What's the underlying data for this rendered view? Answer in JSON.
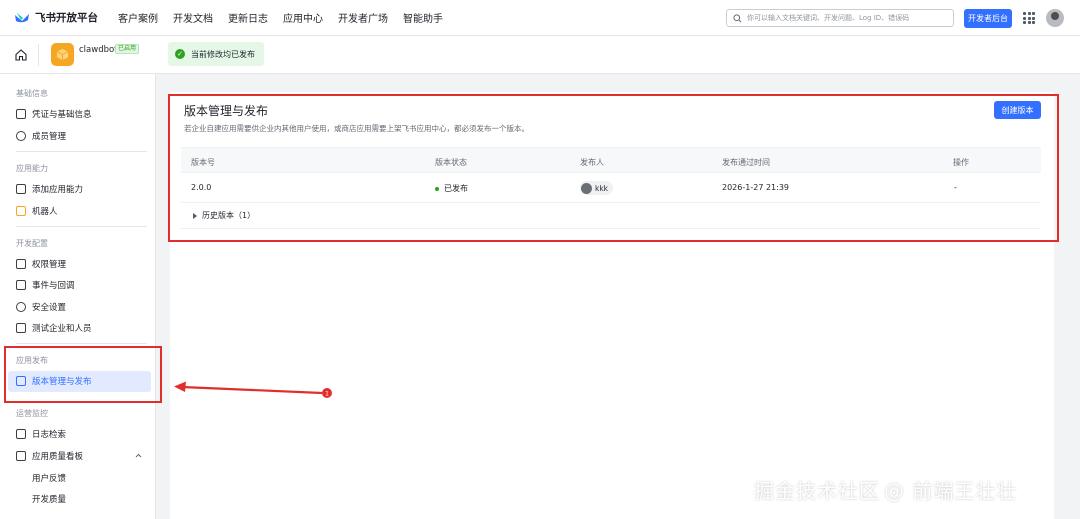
{
  "topbar": {
    "brand": "飞书开放平台",
    "nav": [
      "客户案例",
      "开发文档",
      "更新日志",
      "应用中心",
      "开发者广场",
      "智能助手"
    ],
    "search_placeholder": "你可以输入文档关键词、开发问题、Log ID、错误码",
    "dev_console": "开发者后台"
  },
  "app": {
    "name": "clawdbot",
    "badge": "已启用",
    "publish_status": "当前修改均已发布"
  },
  "sidebar": {
    "groups": [
      {
        "title": "基础信息",
        "items": [
          "凭证与基础信息",
          "成员管理"
        ]
      },
      {
        "title": "应用能力",
        "items": [
          "添加应用能力",
          "机器人"
        ]
      },
      {
        "title": "开发配置",
        "items": [
          "权限管理",
          "事件与回调",
          "安全设置",
          "测试企业和人员"
        ]
      },
      {
        "title": "应用发布",
        "items": [
          "版本管理与发布"
        ]
      },
      {
        "title": "运营监控",
        "items": [
          "日志检索",
          "应用质量看板"
        ],
        "subitems": [
          "用户反馈",
          "开发质量"
        ]
      }
    ]
  },
  "main": {
    "title": "版本管理与发布",
    "description": "若企业自建应用需要供企业内其他用户使用，或商店应用需要上架飞书应用中心，都必须发布一个版本。",
    "create_button": "创建版本",
    "table": {
      "headers": [
        "版本号",
        "版本状态",
        "发布人",
        "发布通过时间",
        "操作"
      ],
      "rows": [
        {
          "version": "2.0.0",
          "status": "已发布",
          "publisher": "kkk",
          "time": "2026-1-27 21:39",
          "action": "-"
        }
      ]
    },
    "history_label": "历史版本（1）"
  },
  "annotation": {
    "marker": "1",
    "color": "#e22d2d"
  },
  "watermark": {
    "left": "掘金技术社区",
    "right": "@ 前端王壮壮"
  },
  "colors": {
    "primary": "#3370ff",
    "success": "#2ea121",
    "annotation": "#e22d2d"
  }
}
